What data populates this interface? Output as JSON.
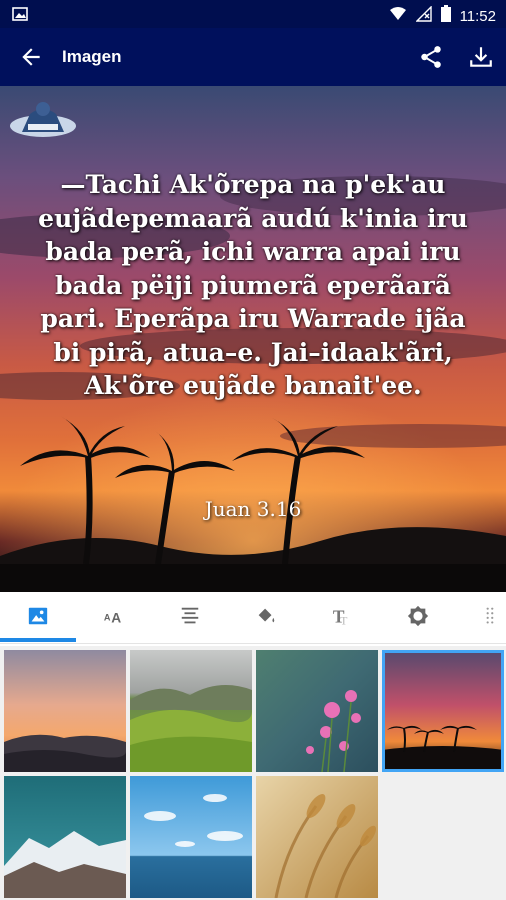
{
  "status_bar": {
    "time": "11:52",
    "icons": [
      "image-icon",
      "wifi-icon",
      "signal-off-icon",
      "battery-icon"
    ]
  },
  "app_bar": {
    "title": "Imagen",
    "back_icon": "arrow-back-icon",
    "actions": [
      "share-icon",
      "download-icon"
    ]
  },
  "preview": {
    "verse_text": "—Tachi Ak'õrepa na p'ek'au eujãdepemaarã audú k'inia iru bada perã, ichi warra apai iru bada pëiji piumerã eperãarã pari. Eperãpa iru Warrade ijãa bi pirã, atua–e. Jai–idaak'ãri, Ak'õre eujãde banait'ee.",
    "verse_reference": "Juan 3.16"
  },
  "tabs": [
    {
      "icon": "image-icon",
      "selected": true
    },
    {
      "icon": "font-size-icon",
      "selected": false
    },
    {
      "icon": "align-center-icon",
      "selected": false
    },
    {
      "icon": "paint-bucket-icon",
      "selected": false
    },
    {
      "icon": "text-style-icon",
      "selected": false
    },
    {
      "icon": "brightness-icon",
      "selected": false
    },
    {
      "icon": "texture-icon",
      "selected": false
    }
  ],
  "thumbnails": [
    {
      "name": "sunset-mountains",
      "selected": false
    },
    {
      "name": "green-hills",
      "selected": false
    },
    {
      "name": "pink-flowers",
      "selected": false
    },
    {
      "name": "palm-sunset",
      "selected": true
    },
    {
      "name": "snowy-mountain",
      "selected": false
    },
    {
      "name": "sky-ocean",
      "selected": false
    },
    {
      "name": "wheat-field",
      "selected": false
    }
  ],
  "colors": {
    "status_bar": "#000e4f",
    "app_bar": "#00105c",
    "accent": "#1e88e5"
  }
}
